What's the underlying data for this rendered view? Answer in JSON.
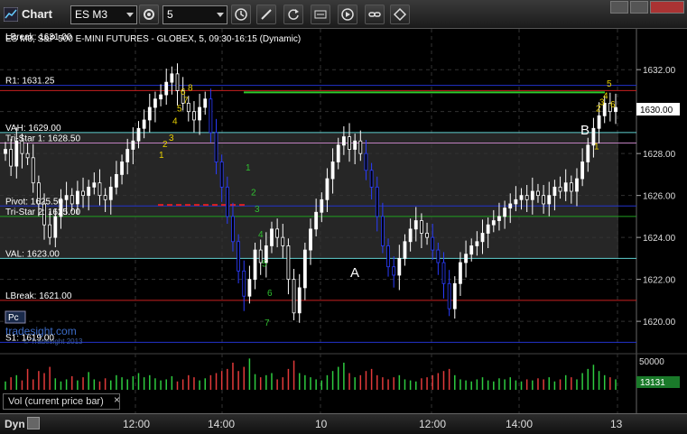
{
  "toolbar": {
    "title": "Chart",
    "symbol": "ES M3",
    "period": "5"
  },
  "chart": {
    "header": "ES M3, S&P 500 E-MINI FUTURES - GLOBEX, 5, 09:30-16:15 (Dynamic)",
    "header_overlay": "LBreak: 1631.00",
    "watermark": "tradesight.com",
    "copyright": "© Tradesight 2013",
    "last_price": "1630.00",
    "level_labels": {
      "r1": "R1: 1631.25",
      "vah": "VAH: 1629.00",
      "tristar1": "Tri-Star 1: 1628.50",
      "pivot": "Pivot: 1625.50",
      "tristar2": "Tri-Star 2: 1625.00",
      "val": "VAL: 1623.00",
      "lbreak": "LBreak: 1621.00",
      "pc": "Pc",
      "s1": "S1: 1619.00"
    },
    "annotations": {
      "A": "A",
      "B": "B"
    },
    "counts": [
      "1",
      "2",
      "3",
      "4",
      "5",
      "6",
      "7",
      "8",
      "9"
    ]
  },
  "chart_data": {
    "type": "candlestick",
    "title": "ES M3, S&P 500 E-MINI FUTURES - GLOBEX, 5, 09:30-16:15 (Dynamic)",
    "y_ticks": [
      1620,
      1622,
      1624,
      1626,
      1628,
      1630,
      1632
    ],
    "y_tick_labels": [
      "1620.00",
      "1622.00",
      "1624.00",
      "1626.00",
      "1628.00",
      "1630.00",
      "1632.00"
    ],
    "ylim": [
      1618.8,
      1633.6
    ],
    "x_tick_labels": [
      "12:00",
      "14:00",
      "10",
      "12:00",
      "14:00",
      "13"
    ],
    "levels": [
      {
        "name": "LBreak",
        "value": 1631.0,
        "color": "#c82020"
      },
      {
        "name": "R1",
        "value": 1631.25,
        "color": "#2233cc"
      },
      {
        "name": "VAH",
        "value": 1629.0,
        "color": "#60d0d0"
      },
      {
        "name": "Tri-Star 1",
        "value": 1628.5,
        "color": "#c080c0"
      },
      {
        "name": "Pivot",
        "value": 1625.5,
        "color": "#2233cc"
      },
      {
        "name": "Tri-Star 2",
        "value": 1625.0,
        "color": "#20a020"
      },
      {
        "name": "VAL",
        "value": 1623.0,
        "color": "#60d0d0"
      },
      {
        "name": "LBreak",
        "value": 1621.0,
        "color": "#c82020"
      },
      {
        "name": "S1",
        "value": 1619.0,
        "color": "#2233cc"
      }
    ],
    "prior_high_line": 1631.0,
    "price_series": [
      1628.2,
      1627.4,
      1628.6,
      1628.0,
      1627.8,
      1626.6,
      1625.6,
      1624.6,
      1624.0,
      1625.0,
      1625.8,
      1626.0,
      1625.6,
      1626.2,
      1626.0,
      1626.4,
      1626.6,
      1626.0,
      1625.8,
      1626.4,
      1627.0,
      1627.6,
      1628.2,
      1628.6,
      1629.2,
      1629.6,
      1630.2,
      1630.6,
      1630.8,
      1631.4,
      1631.8,
      1631.0,
      1630.4,
      1630.0,
      1629.6,
      1630.2,
      1630.6,
      1629.0,
      1627.6,
      1626.4,
      1625.0,
      1623.8,
      1622.4,
      1621.2,
      1622.0,
      1623.4,
      1622.8,
      1623.6,
      1624.4,
      1624.0,
      1623.6,
      1622.0,
      1620.4,
      1621.6,
      1623.4,
      1624.4,
      1625.2,
      1625.8,
      1626.8,
      1627.6,
      1628.4,
      1628.8,
      1628.2,
      1628.6,
      1628.0,
      1627.2,
      1626.4,
      1625.0,
      1623.6,
      1622.6,
      1622.2,
      1623.0,
      1623.8,
      1624.4,
      1624.8,
      1624.2,
      1624.0,
      1623.4,
      1622.8,
      1621.8,
      1620.6,
      1621.8,
      1622.8,
      1623.2,
      1623.6,
      1623.8,
      1624.2,
      1624.6,
      1624.8,
      1625.0,
      1625.4,
      1625.6,
      1625.8,
      1626.0,
      1625.8,
      1626.2,
      1626.0,
      1625.6,
      1626.0,
      1626.4,
      1626.2,
      1626.6,
      1626.2,
      1626.8,
      1627.6,
      1628.4,
      1629.2,
      1629.8,
      1630.4,
      1630.0,
      1630.2
    ],
    "volume": [
      8,
      12,
      14,
      9,
      20,
      10,
      18,
      16,
      22,
      11,
      8,
      10,
      13,
      9,
      12,
      17,
      10,
      8,
      11,
      9,
      14,
      12,
      10,
      13,
      16,
      12,
      14,
      11,
      9,
      10,
      13,
      8,
      10,
      14,
      12,
      9,
      11,
      14,
      16,
      18,
      20,
      26,
      18,
      22,
      30,
      15,
      12,
      14,
      16,
      10,
      12,
      20,
      28,
      16,
      14,
      12,
      10,
      9,
      14,
      18,
      22,
      26,
      16,
      12,
      14,
      18,
      20,
      14,
      12,
      10,
      12,
      14,
      10,
      9,
      8,
      11,
      12,
      14,
      16,
      18,
      20,
      14,
      10,
      9,
      8,
      10,
      12,
      9,
      8,
      11,
      10,
      12,
      9,
      8,
      10,
      9,
      11,
      10,
      12,
      8,
      10,
      14,
      12,
      10,
      16,
      20,
      24,
      18,
      14,
      12,
      10
    ],
    "volume_labels": [
      "50000",
      "13131"
    ]
  },
  "bottom": {
    "vol_tab": "Vol (current price bar)",
    "close": "×",
    "dyn": "Dyn"
  }
}
